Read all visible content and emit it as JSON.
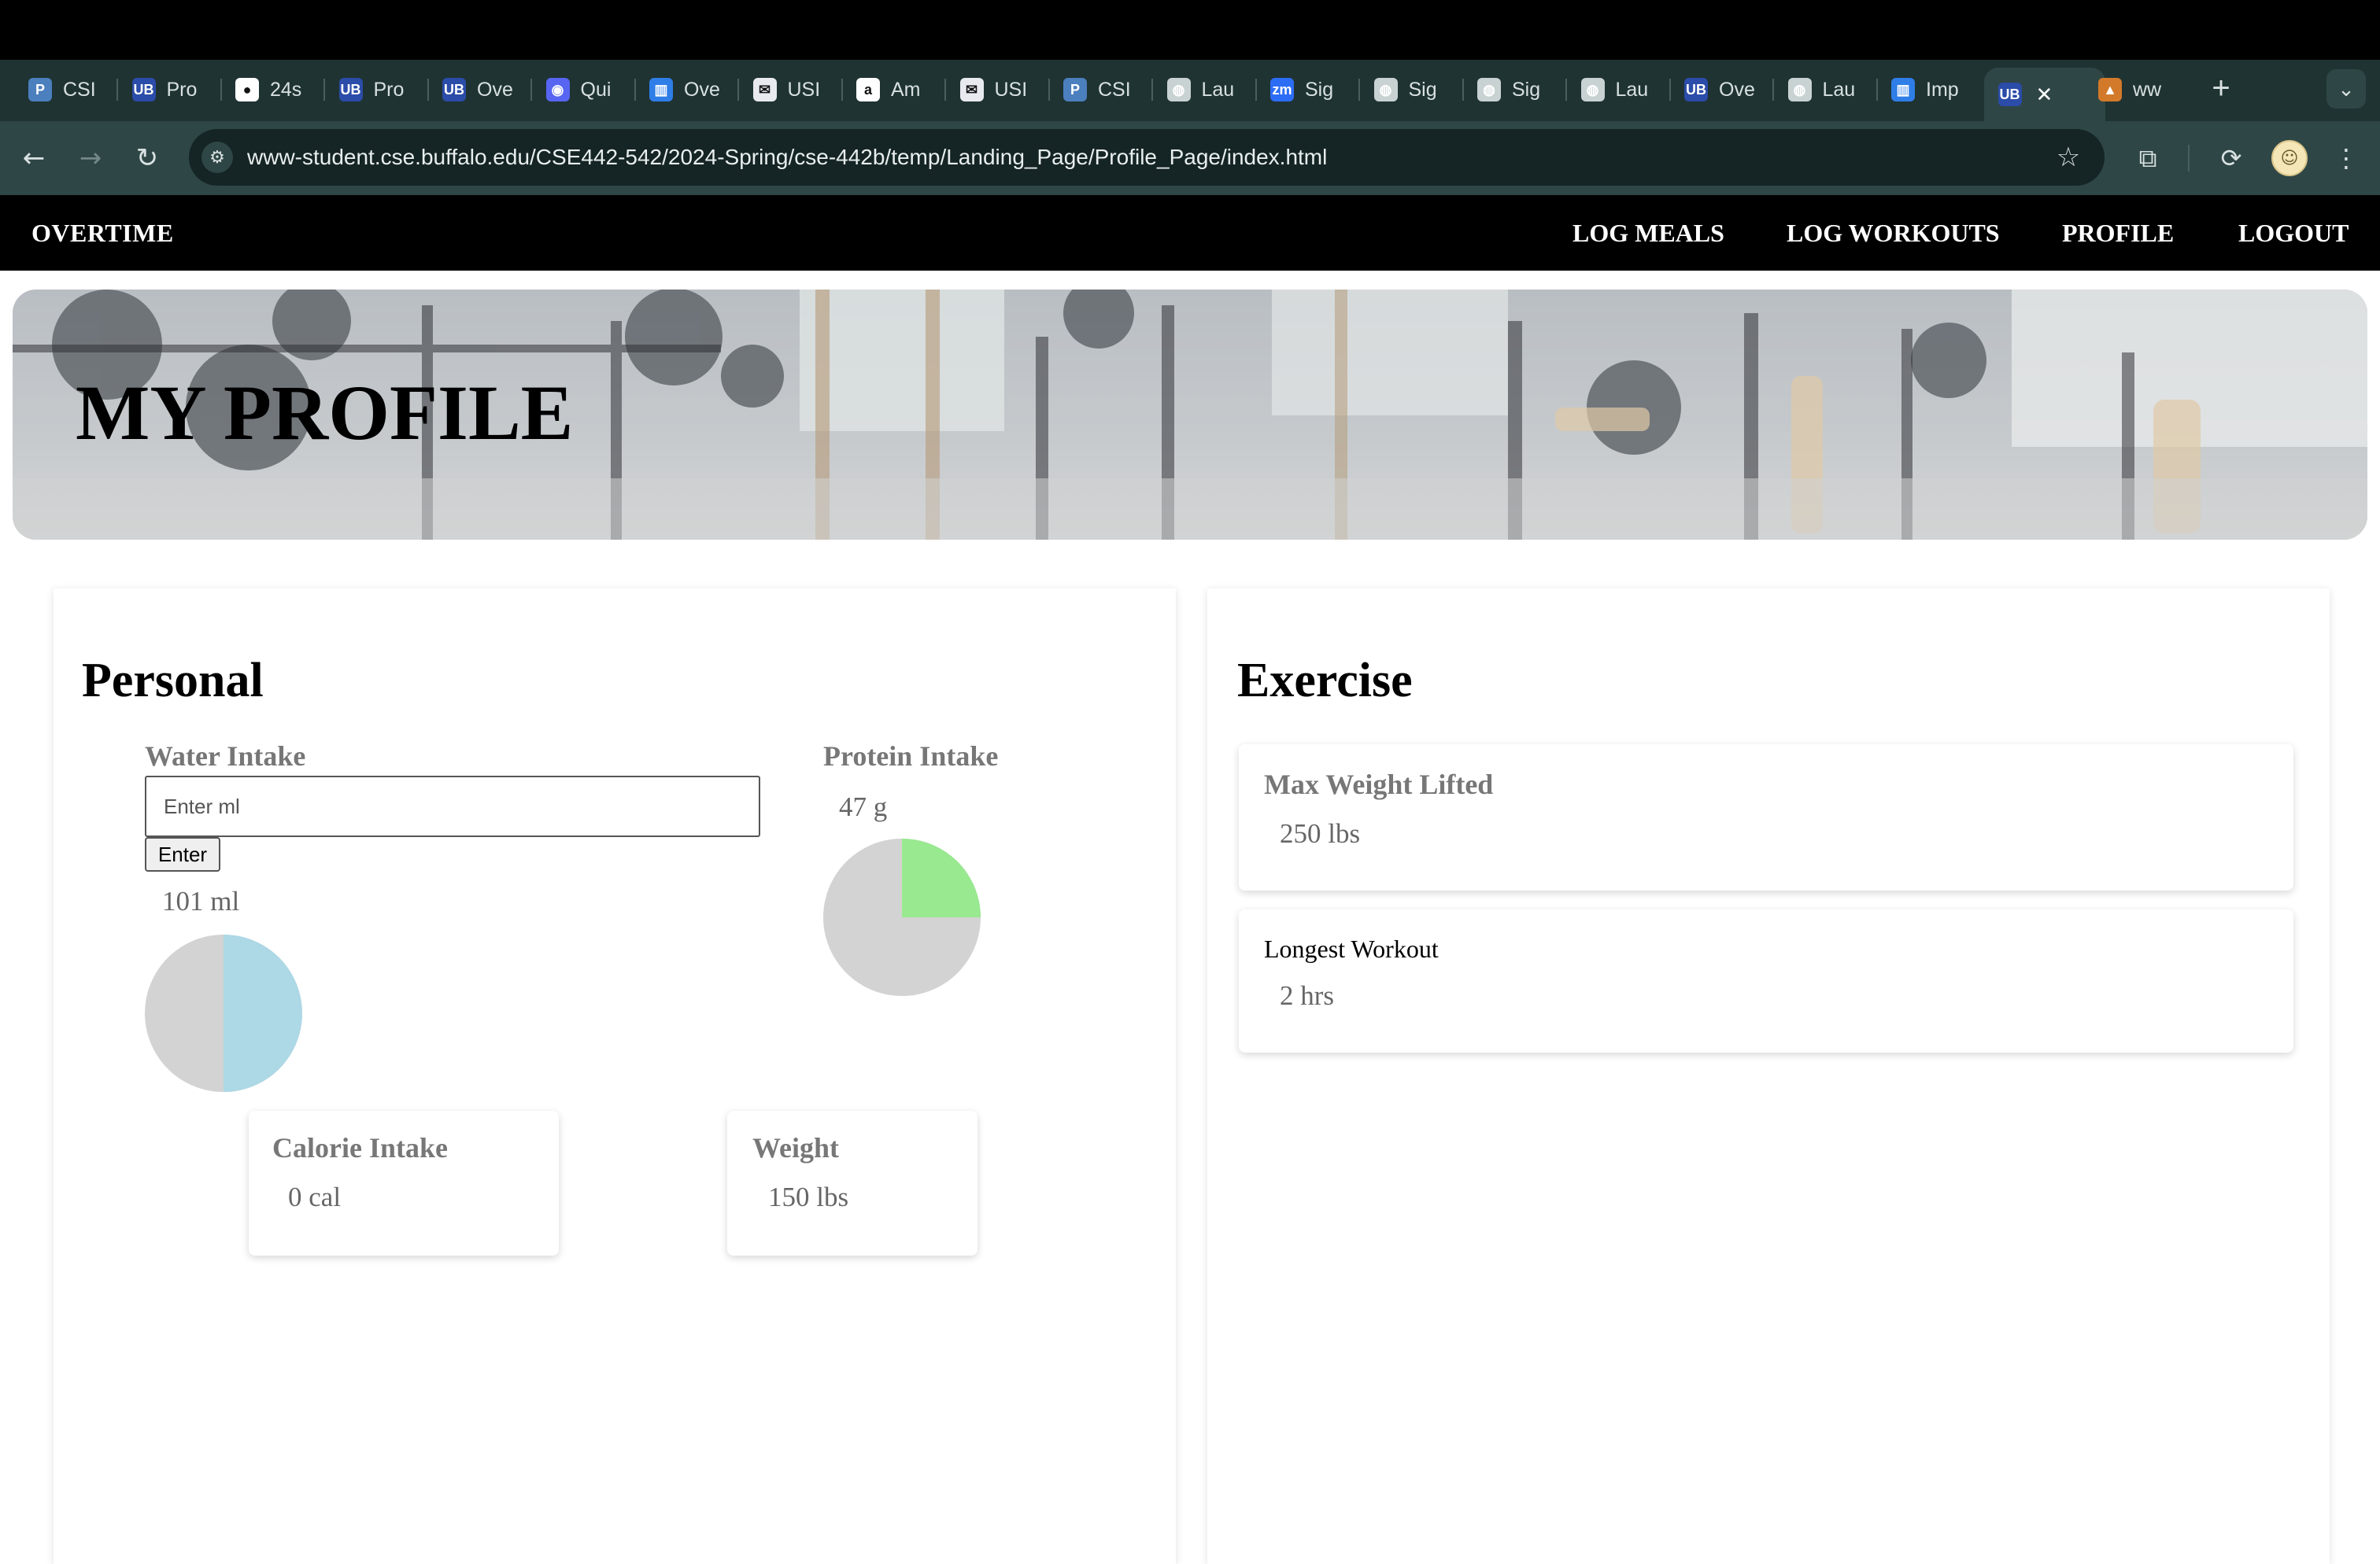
{
  "browser": {
    "tabs": [
      {
        "label": "CSI",
        "icon": "piazza-icon",
        "color": "#4b7fbe"
      },
      {
        "label": "Pro",
        "icon": "ub-icon",
        "color": "#2b4ca8"
      },
      {
        "label": "24s",
        "icon": "github-icon",
        "color": "#ffffff"
      },
      {
        "label": "Pro",
        "icon": "ub-icon",
        "color": "#2b4ca8"
      },
      {
        "label": "Ove",
        "icon": "ub-icon",
        "color": "#2b4ca8"
      },
      {
        "label": "Qui",
        "icon": "discord-icon",
        "color": "#5865f2"
      },
      {
        "label": "Ove",
        "icon": "trello-icon",
        "color": "#2f7ee8"
      },
      {
        "label": "USI",
        "icon": "mail-icon",
        "color": "#e8eaf0"
      },
      {
        "label": "Am",
        "icon": "amazon-icon",
        "color": "#ffffff"
      },
      {
        "label": "USI",
        "icon": "mail-icon",
        "color": "#e8eaf0"
      },
      {
        "label": "CSI",
        "icon": "piazza-icon",
        "color": "#4b7fbe"
      },
      {
        "label": "Lau",
        "icon": "globe-icon",
        "color": "#c9d2d2"
      },
      {
        "label": "Sig",
        "icon": "zoom-icon",
        "color": "#2d6df6"
      },
      {
        "label": "Sig",
        "icon": "globe-icon",
        "color": "#c9d2d2"
      },
      {
        "label": "Sig",
        "icon": "globe-icon",
        "color": "#c9d2d2"
      },
      {
        "label": "Lau",
        "icon": "globe-icon",
        "color": "#c9d2d2"
      },
      {
        "label": "Ove",
        "icon": "ub-icon",
        "color": "#2b4ca8"
      },
      {
        "label": "Lau",
        "icon": "globe-icon",
        "color": "#c9d2d2"
      },
      {
        "label": "Imp",
        "icon": "trello-icon",
        "color": "#2f7ee8"
      },
      {
        "label": "",
        "icon": "ub-icon",
        "color": "#2b4ca8",
        "active": true
      },
      {
        "label": "ww",
        "icon": "ziggurat-icon",
        "color": "#d27a2a"
      }
    ],
    "url": "www-student.cse.buffalo.edu/CSE442-542/2024-Spring/cse-442b/temp/Landing_Page/Profile_Page/index.html"
  },
  "nav": {
    "brand": "OVERTIME",
    "links": [
      "LOG MEALS",
      "LOG WORKOUTS",
      "PROFILE",
      "LOGOUT"
    ]
  },
  "hero": {
    "title": "MY PROFILE"
  },
  "personal": {
    "title": "Personal",
    "water": {
      "label": "Water Intake",
      "placeholder": "Enter ml",
      "button": "Enter",
      "value": "101 ml",
      "fraction": 0.5,
      "fill_color": "#add8e6"
    },
    "protein": {
      "label": "Protein Intake",
      "value": "47 g",
      "fraction": 0.25,
      "fill_color": "#98e98f"
    },
    "calorie": {
      "label": "Calorie Intake",
      "value": "0 cal"
    },
    "weight": {
      "label": "Weight",
      "value": "150 lbs"
    }
  },
  "exercise": {
    "title": "Exercise",
    "max_weight": {
      "label": "Max Weight Lifted",
      "value": "250 lbs"
    },
    "longest_workout": {
      "label": "Longest Workout",
      "value": "2 hrs"
    }
  },
  "colors": {
    "pie_track": "#d3d3d3",
    "browser_frame": "#1f3333"
  }
}
